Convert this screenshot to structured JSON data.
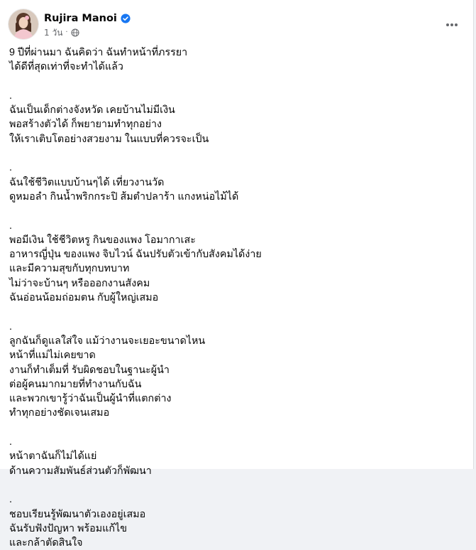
{
  "post": {
    "author": "Rujira Manoi",
    "time": "1 วัน",
    "separator": "·",
    "verified_icon": "verified-badge-icon",
    "privacy_icon": "globe-icon",
    "menu_icon": "more-horizontal-icon",
    "colors": {
      "verified": "#1877f2",
      "text": "#050505",
      "meta": "#65676b"
    },
    "lines": [
      "9 ปีที่ผ่านมา ฉันคิดว่า ฉันทำหน้าที่ภรรยา",
      "ได้ดีที่สุดเท่าที่จะทำได้แล้ว",
      "",
      ".",
      "ฉันเป็นเด็กต่างจังหวัด เคยบ้านไม่มีเงิน",
      "พอสร้างตัวได้ ก็พยายามทำทุกอย่าง",
      "ให้เราเติบโตอย่างสวยงาม ในแบบที่ควรจะเป็น",
      "",
      ".",
      "ฉันใช้ชีวิตแบบบ้านๆได้ เที่ยวงานวัด",
      "ดูหมอลำ กินน้ำพริกกระปิ ส้มตำปลาร้า แกงหน่อไม้ได้",
      "",
      ".",
      "พอมีเงิน ใช้ชีวิตหรู กินของแพง โอมากาเสะ",
      "อาหารญี่ปุ่น ของแพง จิบไวน์ ฉันปรับตัวเข้ากับสังคมได้ง่าย",
      "และมีความสุขกับทุกบทบาท",
      "ไม่ว่าจะบ้านๆ หรือออกงานสังคม",
      "ฉันอ่อนน้อมถ่อมตน กับผู้ใหญ่เสมอ",
      "",
      ".",
      "ลูกฉันก็ดูแลใส่ใจ แม้ว่างานจะเยอะขนาดไหน",
      "หน้าที่แม่ไม่เคยขาด",
      "งานก็ทำเต็มที่ รับผิดชอบในฐานะผู้นำ",
      "ต่อผู้คนมากมายที่ทำงานกับฉัน",
      "และพวกเขารู้ว่าฉันเป็นผู้นำที่แตกต่าง",
      "ทำทุกอย่างชัดเจนเสมอ",
      "",
      ".",
      "หน้าตาฉันก็ไม่ได้แย่",
      "ด้านความสัมพันธ์ส่วนตัวก็พัฒนา",
      "",
      ".",
      "ชอบเรียนรู้พัฒนาตัวเองอยู่เสมอ",
      "ฉันรับฟังปัญหา พร้อมแก้ไข",
      "และกล้าตัดสินใจ"
    ]
  }
}
